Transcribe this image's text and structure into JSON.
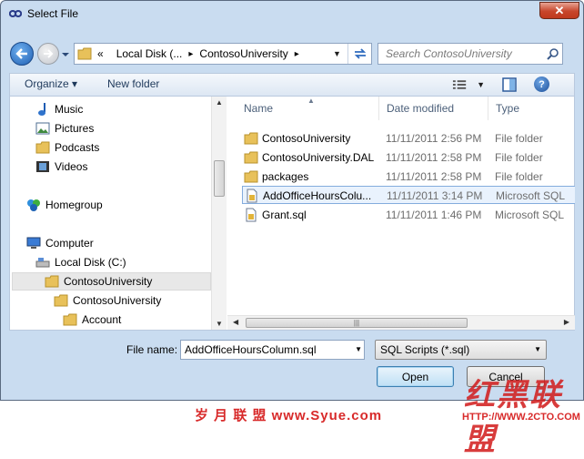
{
  "window": {
    "title": "Select File",
    "close_glyph": "✕"
  },
  "address": {
    "overflow": "«",
    "crumbs": [
      "Local Disk (...",
      "ContosoUniversity"
    ],
    "search_placeholder": "Search ContosoUniversity"
  },
  "toolbar": {
    "organize": "Organize ▾",
    "new_folder": "New folder"
  },
  "nav": {
    "items": [
      {
        "label": "Music",
        "icon": "music-icon"
      },
      {
        "label": "Pictures",
        "icon": "pictures-icon"
      },
      {
        "label": "Podcasts",
        "icon": "folder-icon"
      },
      {
        "label": "Videos",
        "icon": "videos-icon"
      },
      {
        "label": "Homegroup",
        "icon": "homegroup-icon"
      },
      {
        "label": "Computer",
        "icon": "computer-icon"
      },
      {
        "label": "Local Disk (C:)",
        "icon": "disk-icon"
      },
      {
        "label": "ContosoUniversity",
        "icon": "folder-icon"
      },
      {
        "label": "ContosoUniversity",
        "icon": "folder-icon"
      },
      {
        "label": "Account",
        "icon": "folder-icon"
      }
    ]
  },
  "files": {
    "columns": [
      "Name",
      "Date modified",
      "Type"
    ],
    "rows": [
      {
        "name": "ContosoUniversity",
        "date": "11/11/2011 2:56 PM",
        "type": "File folder",
        "icon": "folder-icon"
      },
      {
        "name": "ContosoUniversity.DAL",
        "date": "11/11/2011 2:58 PM",
        "type": "File folder",
        "icon": "folder-icon"
      },
      {
        "name": "packages",
        "date": "11/11/2011 2:58 PM",
        "type": "File folder",
        "icon": "folder-icon"
      },
      {
        "name": "AddOfficeHoursColu...",
        "date": "11/11/2011 3:14 PM",
        "type": "Microsoft SQL",
        "icon": "sql-file-icon"
      },
      {
        "name": "Grant.sql",
        "date": "11/11/2011 1:46 PM",
        "type": "Microsoft SQL",
        "icon": "sql-file-icon"
      }
    ]
  },
  "footer": {
    "file_name_label": "File name:",
    "file_name_value": "AddOfficeHoursColumn.sql",
    "filter_value": "SQL Scripts (*.sql)",
    "open_label": "Open",
    "cancel_label": "Cancel"
  },
  "watermark": {
    "left_text": "岁 月 联 盟  www.Syue.com",
    "logo_text": "红黑联盟",
    "url_text": "HTTP://WWW.2CTO.COM"
  },
  "colors": {
    "selection": "#e9f2fd",
    "accent": "#3c7fb1",
    "watermark": "#d82a2a"
  }
}
